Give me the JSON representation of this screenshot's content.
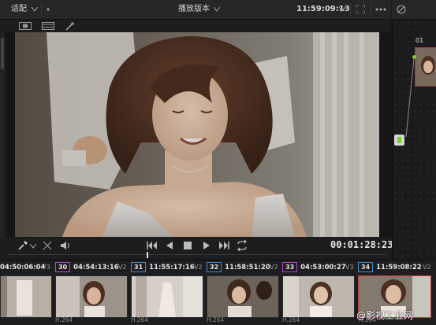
{
  "topbar": {
    "fit_label": "适配",
    "title": "播放版本",
    "source_timecode": "11:59:09:13"
  },
  "controls": {
    "timecode": "00:01:28:23"
  },
  "nodes": {
    "node_label": "01"
  },
  "clips": [
    {
      "tc": "04:50:06:04",
      "track": "V3",
      "codec": "",
      "number": ""
    },
    {
      "number": "30",
      "tc": "04:54:13:16",
      "track": "V2",
      "codec": "H.264",
      "color": "#b04ad6"
    },
    {
      "number": "31",
      "tc": "11:55:17:16",
      "track": "V2",
      "codec": "H.264",
      "color": "#3e8fd6"
    },
    {
      "number": "32",
      "tc": "11:58:51:20",
      "track": "V2",
      "codec": "H.264",
      "color": "#3e8fd6"
    },
    {
      "number": "33",
      "tc": "04:53:00:27",
      "track": "V3",
      "codec": "H.264",
      "color": "#b04ad6"
    },
    {
      "number": "34",
      "tc": "11:59:08:22",
      "track": "V2",
      "codec": "H.264",
      "color": "#3e8fd6"
    }
  ],
  "watermark": "@影视工业网",
  "colors": {
    "accent_selected": "#c83a3a",
    "node_green": "#7ccc2c"
  }
}
